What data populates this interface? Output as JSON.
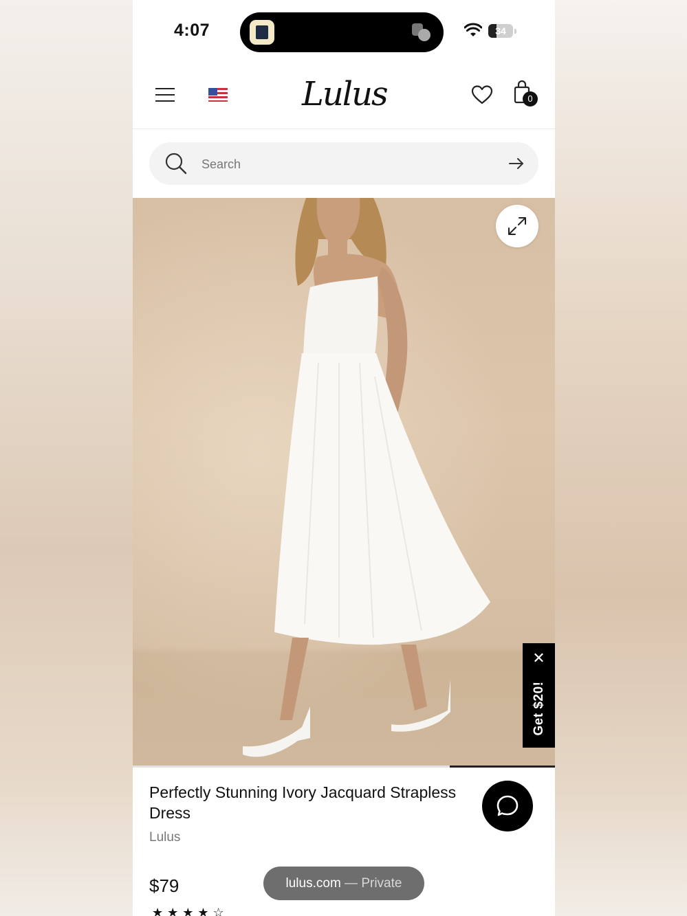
{
  "status_bar": {
    "time": "4:07",
    "battery": "34",
    "battery_level": 0.34
  },
  "header": {
    "logo": "Lulus",
    "flag": "us-flag",
    "bag_count": "0"
  },
  "search": {
    "placeholder": "Search"
  },
  "gallery": {
    "progress_fraction": 0.25
  },
  "promo": {
    "label": "Get $20!"
  },
  "product": {
    "title": "Perfectly Stunning Ivory Jacquard Strapless Dress",
    "brand": "Lulus",
    "price": "$79",
    "rating": 4.5
  },
  "browser": {
    "domain": "lulus.com",
    "separator": "—",
    "mode": "Private"
  },
  "colors": {
    "accent": "#000000",
    "image_backdrop": "#d7bfa4",
    "pill": "#6e6e6e"
  }
}
